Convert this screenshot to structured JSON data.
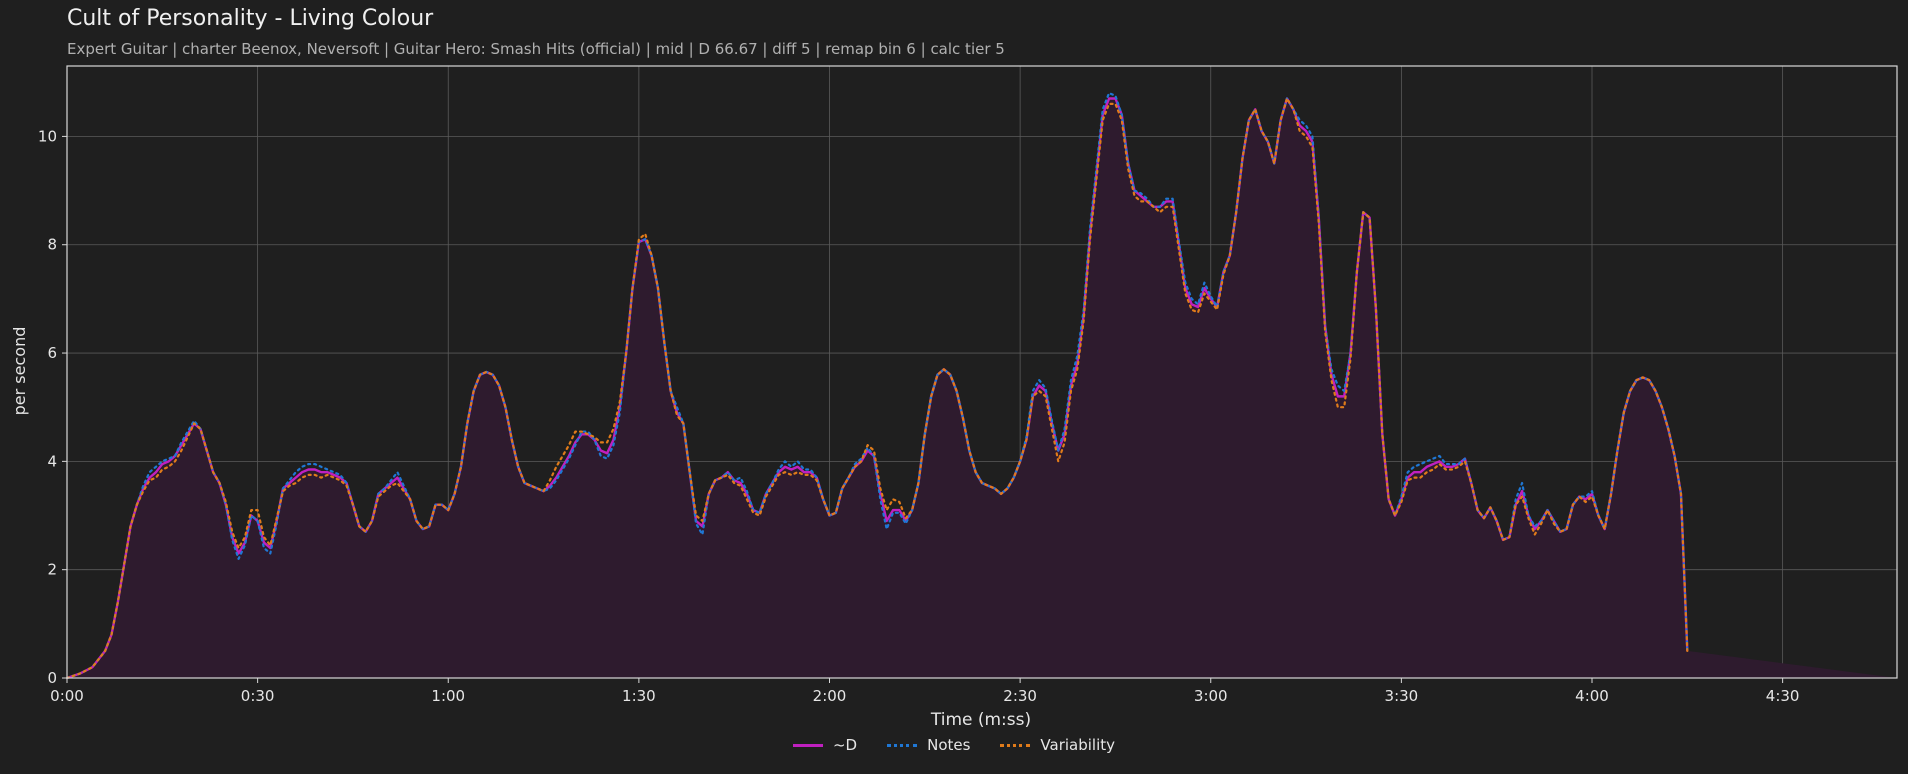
{
  "chart_data": {
    "type": "line",
    "title": "Cult of Personality - Living Colour",
    "subtitle": "Expert Guitar  |  charter Beenox,  Neversoft  |  Guitar Hero: Smash Hits (official)  |  mid  |  D 66.67  |  diff 5  |  remap bin 6  |  calc tier 5",
    "xlabel": "Time (m:ss)",
    "ylabel": "per second",
    "xlim": [
      0,
      288
    ],
    "ylim": [
      0,
      11.3
    ],
    "grid": true,
    "legend_position": "bottom-center",
    "x_ticks": [
      {
        "value": 0,
        "label": "0:00"
      },
      {
        "value": 30,
        "label": "0:30"
      },
      {
        "value": 60,
        "label": "1:00"
      },
      {
        "value": 90,
        "label": "1:30"
      },
      {
        "value": 120,
        "label": "2:00"
      },
      {
        "value": 150,
        "label": "2:30"
      },
      {
        "value": 180,
        "label": "3:00"
      },
      {
        "value": 210,
        "label": "3:30"
      },
      {
        "value": 240,
        "label": "4:00"
      },
      {
        "value": 270,
        "label": "4:30"
      }
    ],
    "y_ticks": [
      {
        "value": 0,
        "label": "0"
      },
      {
        "value": 2,
        "label": "2"
      },
      {
        "value": 4,
        "label": "4"
      },
      {
        "value": 6,
        "label": "6"
      },
      {
        "value": 8,
        "label": "8"
      },
      {
        "value": 10,
        "label": "10"
      }
    ],
    "x": [
      0,
      2,
      4,
      6,
      7,
      8,
      9,
      10,
      11,
      12,
      13,
      14,
      15,
      16,
      17,
      18,
      19,
      20,
      21,
      22,
      23,
      24,
      25,
      26,
      27,
      28,
      29,
      30,
      31,
      32,
      33,
      34,
      35,
      36,
      37,
      38,
      39,
      40,
      41,
      42,
      43,
      44,
      45,
      46,
      47,
      48,
      49,
      50,
      51,
      52,
      53,
      54,
      55,
      56,
      57,
      58,
      59,
      60,
      61,
      62,
      63,
      64,
      65,
      66,
      67,
      68,
      69,
      70,
      71,
      72,
      73,
      74,
      75,
      76,
      77,
      78,
      79,
      80,
      81,
      82,
      83,
      84,
      85,
      86,
      87,
      88,
      89,
      90,
      91,
      92,
      93,
      94,
      95,
      96,
      97,
      98,
      99,
      100,
      101,
      102,
      103,
      104,
      105,
      106,
      107,
      108,
      109,
      110,
      111,
      112,
      113,
      114,
      115,
      116,
      117,
      118,
      119,
      120,
      121,
      122,
      123,
      124,
      125,
      126,
      127,
      128,
      129,
      130,
      131,
      132,
      133,
      134,
      135,
      136,
      137,
      138,
      139,
      140,
      141,
      142,
      143,
      144,
      145,
      146,
      147,
      148,
      149,
      150,
      151,
      152,
      153,
      154,
      155,
      156,
      157,
      158,
      159,
      160,
      161,
      162,
      163,
      164,
      165,
      166,
      167,
      168,
      169,
      170,
      171,
      172,
      173,
      174,
      175,
      176,
      177,
      178,
      179,
      180,
      181,
      182,
      183,
      184,
      185,
      186,
      187,
      188,
      189,
      190,
      191,
      192,
      193,
      194,
      195,
      196,
      197,
      198,
      199,
      200,
      201,
      202,
      203,
      204,
      205,
      206,
      207,
      208,
      209,
      210,
      211,
      212,
      213,
      214,
      215,
      216,
      217,
      218,
      219,
      220,
      221,
      222,
      223,
      224,
      225,
      226,
      227,
      228,
      229,
      230,
      231,
      232,
      233,
      234,
      235,
      236,
      237,
      238,
      239,
      240,
      241,
      242,
      243,
      244,
      245,
      246,
      247,
      248,
      249,
      250,
      251,
      252,
      253,
      254,
      255,
      256,
      257,
      258,
      259,
      260,
      261,
      262,
      263,
      264,
      265,
      266,
      267,
      268,
      269,
      270,
      271,
      272,
      273,
      274,
      275,
      276,
      277,
      278,
      279,
      280,
      281,
      282,
      283,
      284,
      285,
      286,
      287,
      288
    ],
    "series": [
      {
        "name": "~D",
        "color": "#c020c0",
        "style": "solid",
        "values": [
          0,
          0.08,
          0.2,
          0.5,
          0.8,
          1.4,
          2.1,
          2.8,
          3.2,
          3.5,
          3.7,
          3.8,
          3.95,
          4.0,
          4.1,
          4.3,
          4.5,
          4.7,
          4.6,
          4.2,
          3.8,
          3.6,
          3.2,
          2.6,
          2.3,
          2.5,
          3.0,
          2.9,
          2.5,
          2.4,
          2.9,
          3.5,
          3.6,
          3.7,
          3.8,
          3.85,
          3.85,
          3.8,
          3.8,
          3.75,
          3.7,
          3.6,
          3.2,
          2.8,
          2.7,
          2.9,
          3.4,
          3.5,
          3.6,
          3.7,
          3.5,
          3.3,
          2.9,
          2.75,
          2.8,
          3.2,
          3.2,
          3.1,
          3.4,
          3.9,
          4.7,
          5.3,
          5.6,
          5.65,
          5.6,
          5.4,
          5.0,
          4.4,
          3.9,
          3.6,
          3.55,
          3.5,
          3.45,
          3.55,
          3.7,
          3.9,
          4.1,
          4.35,
          4.5,
          4.5,
          4.4,
          4.2,
          4.15,
          4.4,
          5.0,
          6.0,
          7.2,
          8.05,
          8.1,
          7.8,
          7.2,
          6.2,
          5.3,
          4.9,
          4.7,
          3.8,
          2.9,
          2.8,
          3.4,
          3.65,
          3.7,
          3.8,
          3.65,
          3.6,
          3.4,
          3.1,
          3.05,
          3.4,
          3.6,
          3.8,
          3.9,
          3.85,
          3.9,
          3.8,
          3.8,
          3.7,
          3.3,
          3.0,
          3.05,
          3.5,
          3.7,
          3.9,
          4.0,
          4.2,
          4.1,
          3.4,
          2.9,
          3.1,
          3.1,
          2.9,
          3.1,
          3.6,
          4.5,
          5.2,
          5.6,
          5.7,
          5.6,
          5.3,
          4.8,
          4.2,
          3.8,
          3.6,
          3.55,
          3.5,
          3.4,
          3.5,
          3.7,
          4.0,
          4.4,
          5.2,
          5.4,
          5.3,
          4.7,
          4.2,
          4.5,
          5.4,
          5.8,
          6.7,
          8.2,
          9.3,
          10.4,
          10.7,
          10.7,
          10.4,
          9.5,
          9.0,
          8.9,
          8.8,
          8.7,
          8.7,
          8.8,
          8.8,
          8.0,
          7.2,
          6.9,
          6.85,
          7.2,
          7.0,
          6.85,
          7.5,
          7.8,
          8.6,
          9.6,
          10.3,
          10.5,
          10.1,
          9.9,
          9.5,
          10.3,
          10.7,
          10.5,
          10.2,
          10.1,
          9.9,
          8.5,
          6.5,
          5.6,
          5.2,
          5.2,
          6.0,
          7.5,
          8.6,
          8.5,
          6.8,
          4.5,
          3.3,
          3.0,
          3.3,
          3.7,
          3.8,
          3.8,
          3.9,
          3.95,
          4.0,
          3.9,
          3.9,
          3.95,
          4.05,
          3.6,
          3.1,
          2.95,
          3.15,
          2.9,
          2.55,
          2.6,
          3.2,
          3.45,
          3.0,
          2.75,
          2.9,
          3.1,
          2.9,
          2.7,
          2.75,
          3.2,
          3.35,
          3.3,
          3.4,
          3.0,
          2.75,
          3.4,
          4.2,
          4.9,
          5.3,
          5.5,
          5.55,
          5.5,
          5.3,
          5.0,
          4.6,
          4.1,
          3.4,
          0.5
        ]
      },
      {
        "name": "Notes",
        "color": "#1f77d4",
        "style": "dotted",
        "values": [
          0,
          0.08,
          0.2,
          0.5,
          0.8,
          1.4,
          2.1,
          2.8,
          3.2,
          3.55,
          3.8,
          3.9,
          4.0,
          4.05,
          4.1,
          4.35,
          4.55,
          4.75,
          4.6,
          4.2,
          3.8,
          3.6,
          3.2,
          2.55,
          2.2,
          2.45,
          3.0,
          2.9,
          2.4,
          2.3,
          2.85,
          3.5,
          3.65,
          3.8,
          3.9,
          3.95,
          3.95,
          3.9,
          3.85,
          3.8,
          3.75,
          3.6,
          3.2,
          2.8,
          2.7,
          2.9,
          3.4,
          3.5,
          3.65,
          3.8,
          3.55,
          3.3,
          2.9,
          2.75,
          2.8,
          3.2,
          3.2,
          3.1,
          3.4,
          3.9,
          4.7,
          5.3,
          5.6,
          5.65,
          5.6,
          5.4,
          5.0,
          4.4,
          3.9,
          3.6,
          3.55,
          3.5,
          3.45,
          3.5,
          3.65,
          3.85,
          4.05,
          4.3,
          4.55,
          4.55,
          4.4,
          4.1,
          4.05,
          4.3,
          4.9,
          6.0,
          7.2,
          8.05,
          8.1,
          7.8,
          7.2,
          6.2,
          5.3,
          5.0,
          4.7,
          3.8,
          2.85,
          2.65,
          3.4,
          3.65,
          3.7,
          3.8,
          3.65,
          3.7,
          3.45,
          3.1,
          3.05,
          3.4,
          3.6,
          3.85,
          4.0,
          3.9,
          4.0,
          3.85,
          3.85,
          3.7,
          3.3,
          3.0,
          3.05,
          3.5,
          3.7,
          3.95,
          4.05,
          4.25,
          4.1,
          3.3,
          2.75,
          3.05,
          3.05,
          2.85,
          3.1,
          3.6,
          4.5,
          5.2,
          5.6,
          5.7,
          5.6,
          5.3,
          4.8,
          4.2,
          3.8,
          3.6,
          3.55,
          3.5,
          3.4,
          3.5,
          3.7,
          4.0,
          4.45,
          5.3,
          5.5,
          5.35,
          4.75,
          4.2,
          4.6,
          5.5,
          5.95,
          6.8,
          8.3,
          9.4,
          10.5,
          10.8,
          10.75,
          10.4,
          9.5,
          9.0,
          8.95,
          8.85,
          8.7,
          8.7,
          8.85,
          8.85,
          8.05,
          7.3,
          7.0,
          6.9,
          7.3,
          7.05,
          6.85,
          7.5,
          7.8,
          8.6,
          9.6,
          10.3,
          10.5,
          10.1,
          9.9,
          9.5,
          10.3,
          10.7,
          10.5,
          10.3,
          10.2,
          10.0,
          8.5,
          6.5,
          5.7,
          5.4,
          5.3,
          6.0,
          7.5,
          8.6,
          8.5,
          6.8,
          4.5,
          3.3,
          3.0,
          3.35,
          3.8,
          3.9,
          3.95,
          4.0,
          4.05,
          4.1,
          3.95,
          3.95,
          3.95,
          4.05,
          3.6,
          3.1,
          2.95,
          3.15,
          2.9,
          2.55,
          2.6,
          3.3,
          3.6,
          3.0,
          2.8,
          2.9,
          3.1,
          2.9,
          2.7,
          2.75,
          3.2,
          3.35,
          3.35,
          3.45,
          3.0,
          2.75,
          3.4,
          4.2,
          4.9,
          5.3,
          5.5,
          5.55,
          5.5,
          5.3,
          5.0,
          4.6,
          4.1,
          3.4,
          0.5
        ]
      },
      {
        "name": "Variability",
        "color": "#e07b1a",
        "style": "dotted",
        "values": [
          0,
          0.08,
          0.2,
          0.5,
          0.8,
          1.4,
          2.1,
          2.8,
          3.2,
          3.45,
          3.65,
          3.7,
          3.85,
          3.9,
          4.0,
          4.2,
          4.45,
          4.7,
          4.6,
          4.2,
          3.8,
          3.6,
          3.25,
          2.7,
          2.4,
          2.6,
          3.1,
          3.1,
          2.6,
          2.45,
          2.95,
          3.45,
          3.55,
          3.6,
          3.7,
          3.75,
          3.75,
          3.7,
          3.75,
          3.7,
          3.65,
          3.55,
          3.2,
          2.8,
          2.7,
          2.9,
          3.35,
          3.45,
          3.55,
          3.6,
          3.45,
          3.3,
          2.9,
          2.75,
          2.8,
          3.2,
          3.2,
          3.1,
          3.4,
          3.9,
          4.7,
          5.3,
          5.6,
          5.65,
          5.6,
          5.4,
          5.0,
          4.4,
          3.9,
          3.6,
          3.55,
          3.5,
          3.45,
          3.65,
          3.9,
          4.1,
          4.3,
          4.55,
          4.55,
          4.5,
          4.45,
          4.35,
          4.35,
          4.6,
          5.1,
          6.0,
          7.2,
          8.1,
          8.2,
          7.8,
          7.2,
          6.2,
          5.3,
          4.85,
          4.7,
          3.8,
          3.0,
          2.9,
          3.4,
          3.65,
          3.7,
          3.75,
          3.6,
          3.55,
          3.3,
          3.05,
          3.0,
          3.35,
          3.55,
          3.75,
          3.8,
          3.75,
          3.8,
          3.75,
          3.75,
          3.65,
          3.3,
          3.0,
          3.05,
          3.5,
          3.7,
          3.9,
          4.0,
          4.3,
          4.2,
          3.5,
          3.1,
          3.3,
          3.25,
          2.95,
          3.1,
          3.6,
          4.5,
          5.2,
          5.6,
          5.7,
          5.6,
          5.3,
          4.8,
          4.2,
          3.8,
          3.6,
          3.55,
          3.5,
          3.4,
          3.5,
          3.7,
          4.0,
          4.4,
          5.2,
          5.3,
          5.2,
          4.6,
          4.0,
          4.35,
          5.3,
          5.7,
          6.6,
          8.1,
          9.2,
          10.3,
          10.6,
          10.6,
          10.3,
          9.4,
          8.9,
          8.8,
          8.8,
          8.7,
          8.6,
          8.7,
          8.7,
          7.9,
          7.1,
          6.8,
          6.75,
          7.1,
          6.95,
          6.8,
          7.45,
          7.8,
          8.6,
          9.6,
          10.3,
          10.5,
          10.1,
          9.9,
          9.5,
          10.3,
          10.7,
          10.5,
          10.1,
          10.0,
          9.8,
          8.4,
          6.4,
          5.5,
          5.0,
          5.0,
          5.9,
          7.5,
          8.6,
          8.5,
          6.8,
          4.5,
          3.3,
          3.0,
          3.25,
          3.65,
          3.7,
          3.7,
          3.8,
          3.85,
          3.95,
          3.85,
          3.85,
          3.9,
          4.0,
          3.6,
          3.1,
          2.95,
          3.15,
          2.9,
          2.55,
          2.6,
          3.2,
          3.35,
          2.95,
          2.65,
          2.85,
          3.1,
          2.85,
          2.7,
          2.75,
          3.2,
          3.35,
          3.25,
          3.35,
          3.0,
          2.75,
          3.4,
          4.2,
          4.9,
          5.3,
          5.5,
          5.55,
          5.5,
          5.3,
          5.0,
          4.6,
          4.1,
          3.4,
          0.5
        ]
      }
    ]
  }
}
